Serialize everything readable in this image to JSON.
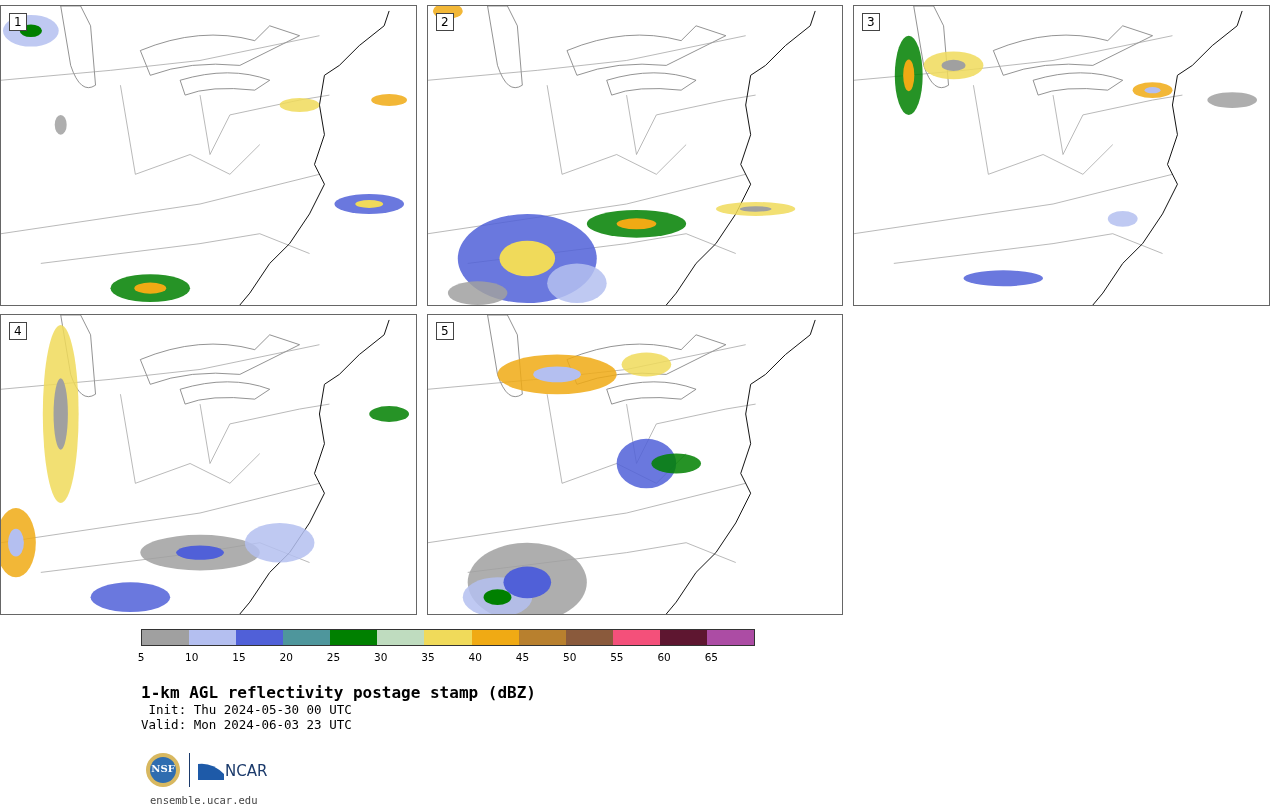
{
  "panels": [
    {
      "label": "1"
    },
    {
      "label": "2"
    },
    {
      "label": "3"
    },
    {
      "label": "4"
    },
    {
      "label": "5"
    }
  ],
  "colorbar": {
    "segments": [
      {
        "color": "#a0a0a0"
      },
      {
        "color": "#b4bff0"
      },
      {
        "color": "#5060d8"
      },
      {
        "color": "#4e969c"
      },
      {
        "color": "#008000"
      },
      {
        "color": "#bfdcbf"
      },
      {
        "color": "#f0da5a"
      },
      {
        "color": "#f0aa14"
      },
      {
        "color": "#b8802e"
      },
      {
        "color": "#8a5a3c"
      },
      {
        "color": "#f4507a"
      },
      {
        "color": "#5e1630"
      },
      {
        "color": "#ac4ca4"
      }
    ],
    "ticks": [
      "5",
      "10",
      "15",
      "20",
      "25",
      "30",
      "35",
      "40",
      "45",
      "50",
      "55",
      "60",
      "65"
    ]
  },
  "title": "1-km AGL reflectivity postage stamp (dBZ)",
  "init": " Init: Thu 2024-05-30 00 UTC",
  "valid": "Valid: Mon 2024-06-03 23 UTC",
  "logos": {
    "nsf": "NSF",
    "ncar": "NCAR"
  },
  "site": "ensemble.ucar.edu"
}
